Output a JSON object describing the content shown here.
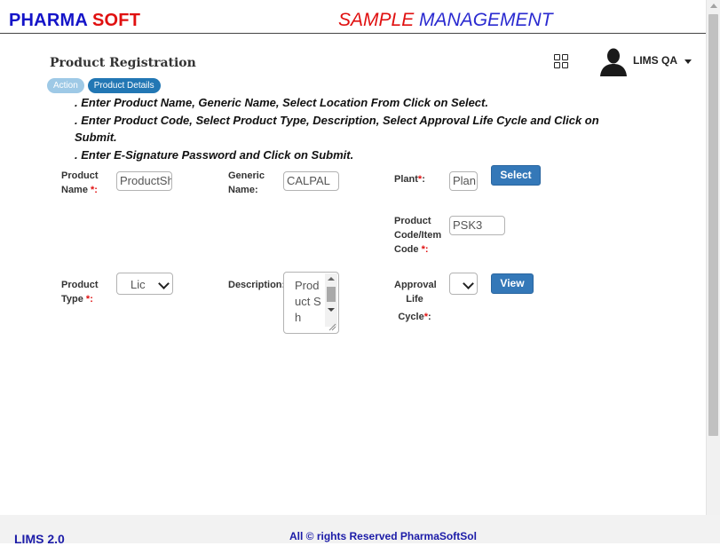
{
  "header": {
    "brand_part1": "PHARMA",
    "brand_part2": "SOFT",
    "title_part1": "SAMPLE",
    "title_part2": "MANAGEMENT"
  },
  "page": {
    "title": "Product Registration",
    "breadcrumbs": [
      "Action",
      "Product Details"
    ]
  },
  "user": {
    "name": "LIMS QA",
    "avatar_icon": "user-silhouette-icon",
    "apps_icon": "grid-icon"
  },
  "instructions": [
    ". Enter Product Name, Generic Name, Select Location From Click on Select.",
    ". Enter Product Code, Select Product Type, Description, Select Approval Life Cycle and Click on Submit.",
    ". Enter E-Signature Password and Click on Submit."
  ],
  "form": {
    "product_name": {
      "label_1": "Product",
      "label_2": "Name",
      "required_mark": "*:",
      "value": "ProductSh"
    },
    "generic_name": {
      "label_1": "Generic",
      "label_2": "Name:",
      "value": "CALPAL"
    },
    "plant": {
      "label": "Plant",
      "required_mark": "*",
      "suffix": ":",
      "value": "Plan",
      "button": "Select"
    },
    "product_code": {
      "label_1": "Product",
      "label_2": "Code/Item",
      "label_3": "Code",
      "required_mark": "*:",
      "value": "PSK3"
    },
    "product_type": {
      "label_1": "Product",
      "label_2": "Type",
      "required_mark": "*:",
      "value": "Lic"
    },
    "description": {
      "label": "Description:",
      "value": "Product Sh"
    },
    "approval_life_cycle": {
      "label_1": "Approval",
      "label_2": "Life",
      "label_3": "Cycle",
      "required_mark": "*",
      "suffix": ":",
      "value": "",
      "button": "View"
    }
  },
  "footer": {
    "version": "LIMS 2.0",
    "copyright": "All © rights Reserved PharmaSoftSol"
  }
}
